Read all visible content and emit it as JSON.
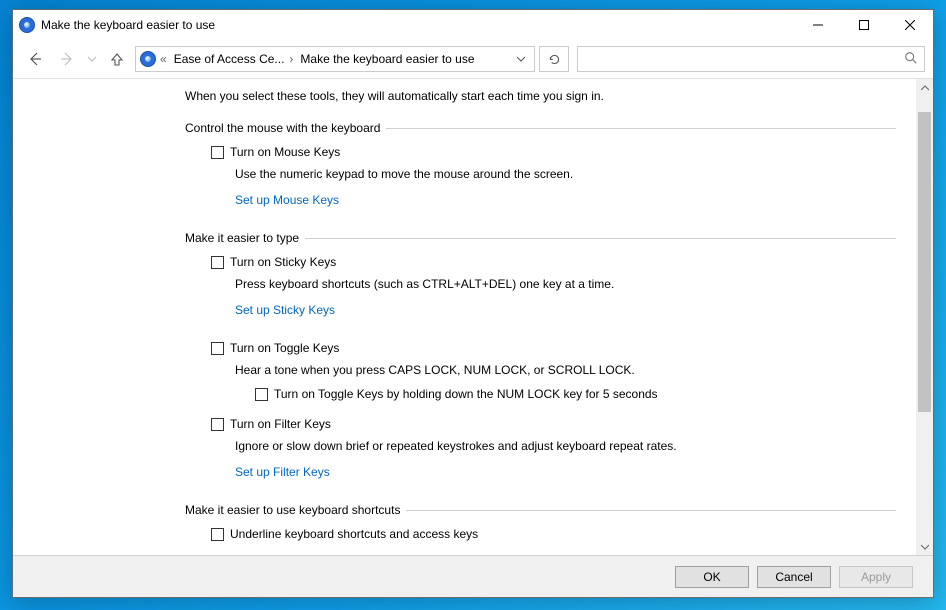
{
  "window": {
    "title": "Make the keyboard easier to use"
  },
  "breadcrumb": {
    "prefix": "«",
    "parent": "Ease of Access Ce...",
    "current": "Make the keyboard easier to use"
  },
  "search": {
    "placeholder": ""
  },
  "intro": "When you select these tools, they will automatically start each time you sign in.",
  "groups": {
    "mouse": {
      "legend": "Control the mouse with the keyboard",
      "mouseKeys": {
        "label": "Turn on Mouse Keys",
        "desc": "Use the numeric keypad to move the mouse around the screen.",
        "link": "Set up Mouse Keys"
      }
    },
    "type": {
      "legend": "Make it easier to type",
      "sticky": {
        "label": "Turn on Sticky Keys",
        "desc": "Press keyboard shortcuts (such as CTRL+ALT+DEL) one key at a time.",
        "link": "Set up Sticky Keys"
      },
      "toggle": {
        "label": "Turn on Toggle Keys",
        "desc": "Hear a tone when you press CAPS LOCK, NUM LOCK, or SCROLL LOCK.",
        "sub": "Turn on Toggle Keys by holding down the NUM LOCK key for 5 seconds"
      },
      "filter": {
        "label": "Turn on Filter Keys",
        "desc": "Ignore or slow down brief or repeated keystrokes and adjust keyboard repeat rates.",
        "link": "Set up Filter Keys"
      }
    },
    "shortcuts": {
      "legend": "Make it easier to use keyboard shortcuts",
      "underline": {
        "label": "Underline keyboard shortcuts and access keys"
      }
    }
  },
  "footer": {
    "ok": "OK",
    "cancel": "Cancel",
    "apply": "Apply"
  }
}
